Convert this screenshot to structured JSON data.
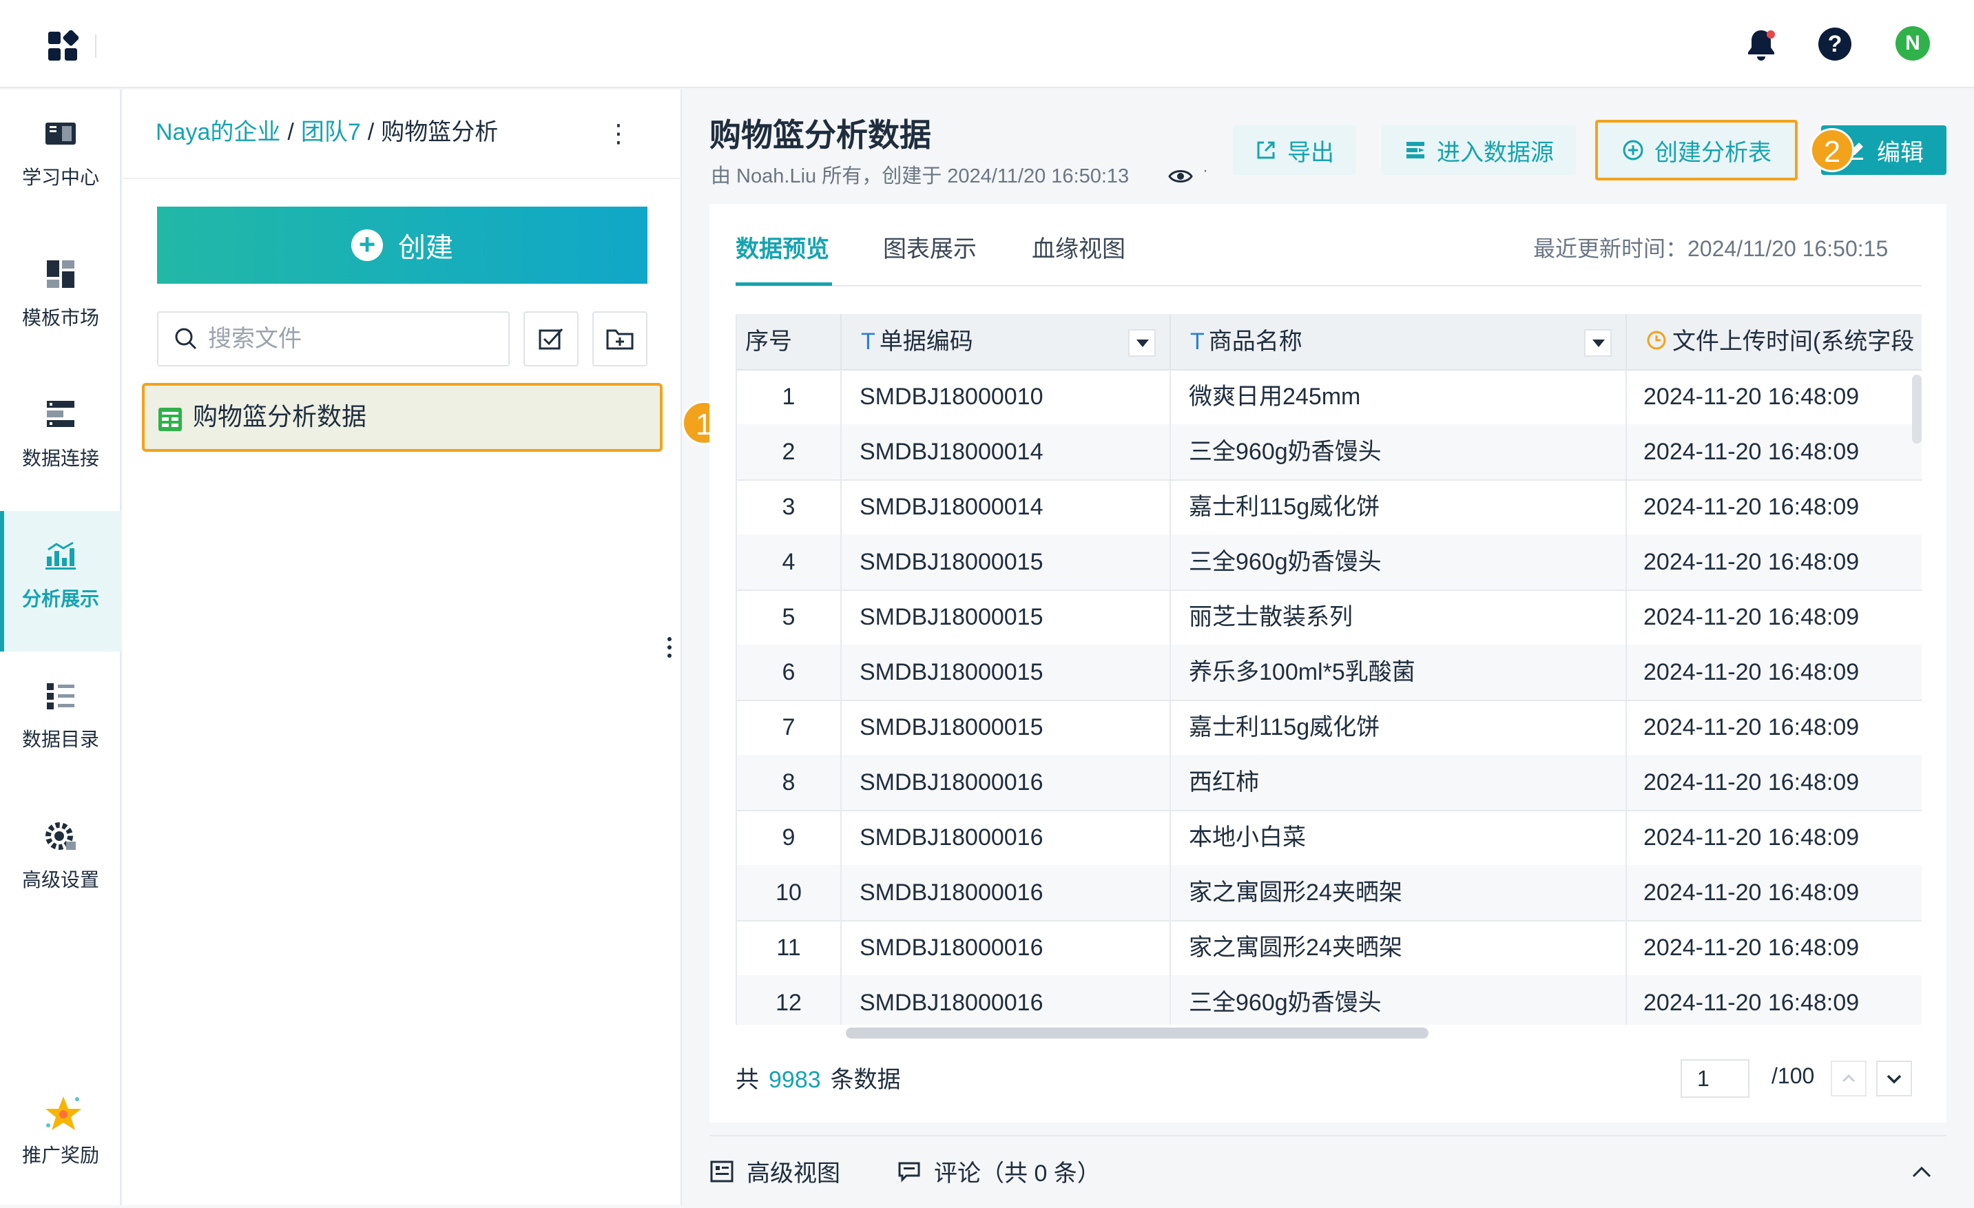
{
  "topbar": {
    "apps_icon": "grid-apps-icon",
    "bell_icon": "bell-icon",
    "help_label": "?",
    "avatar_letter": "N"
  },
  "leftnav": {
    "items": [
      {
        "label": "学习中心",
        "icon": "book-icon"
      },
      {
        "label": "模板市场",
        "icon": "template-icon"
      },
      {
        "label": "数据连接",
        "icon": "database-link-icon"
      },
      {
        "label": "分析展示",
        "icon": "chart-icon",
        "active": true
      },
      {
        "label": "数据目录",
        "icon": "list-icon"
      },
      {
        "label": "高级设置",
        "icon": "gear-icon"
      }
    ],
    "bottom": {
      "label": "推广奖励",
      "icon": "star-icon"
    }
  },
  "filepanel": {
    "breadcrumb": [
      "Naya的企业",
      "团队7",
      "购物篮分析"
    ],
    "create_label": "创建",
    "search_placeholder": "搜索文件",
    "file_name": "购物篮分析数据",
    "badge1": "1"
  },
  "main": {
    "title": "购物篮分析数据",
    "meta": "由 Noah.Liu 所有，创建于 2024/11/20 16:50:13",
    "meta_suffix": "·",
    "buttons": {
      "export": "导出",
      "datasource": "进入数据源",
      "create_analysis": "创建分析表",
      "edit": "编辑"
    },
    "badge2": "2",
    "tabs": [
      "数据预览",
      "图表展示",
      "血缘视图"
    ],
    "last_update": "最近更新时间：2024/11/20 16:50:15",
    "table": {
      "headers": [
        "序号",
        "单据编码",
        "商品名称",
        "文件上传时间(系统字段"
      ],
      "rows": [
        [
          "1",
          "SMDBJ18000010",
          "微爽日用245mm",
          "2024-11-20 16:48:09"
        ],
        [
          "2",
          "SMDBJ18000014",
          "三全960g奶香馒头",
          "2024-11-20 16:48:09"
        ],
        [
          "3",
          "SMDBJ18000014",
          "嘉士利115g威化饼",
          "2024-11-20 16:48:09"
        ],
        [
          "4",
          "SMDBJ18000015",
          "三全960g奶香馒头",
          "2024-11-20 16:48:09"
        ],
        [
          "5",
          "SMDBJ18000015",
          "丽芝士散装系列",
          "2024-11-20 16:48:09"
        ],
        [
          "6",
          "SMDBJ18000015",
          "养乐多100ml*5乳酸菌",
          "2024-11-20 16:48:09"
        ],
        [
          "7",
          "SMDBJ18000015",
          "嘉士利115g威化饼",
          "2024-11-20 16:48:09"
        ],
        [
          "8",
          "SMDBJ18000016",
          "西红柿",
          "2024-11-20 16:48:09"
        ],
        [
          "9",
          "SMDBJ18000016",
          "本地小白菜",
          "2024-11-20 16:48:09"
        ],
        [
          "10",
          "SMDBJ18000016",
          "家之寓圆形24夹晒架",
          "2024-11-20 16:48:09"
        ],
        [
          "11",
          "SMDBJ18000016",
          "家之寓圆形24夹晒架",
          "2024-11-20 16:48:09"
        ],
        [
          "12",
          "SMDBJ18000016",
          "三全960g奶香馒头",
          "2024-11-20 16:48:09"
        ]
      ]
    },
    "footer": {
      "count_prefix": "共",
      "count": "9983",
      "count_suffix": "条数据",
      "page": "1",
      "page_total": "/100"
    },
    "bottom": {
      "advanced_view": "高级视图",
      "comments": "评论（共 0 条）"
    }
  }
}
